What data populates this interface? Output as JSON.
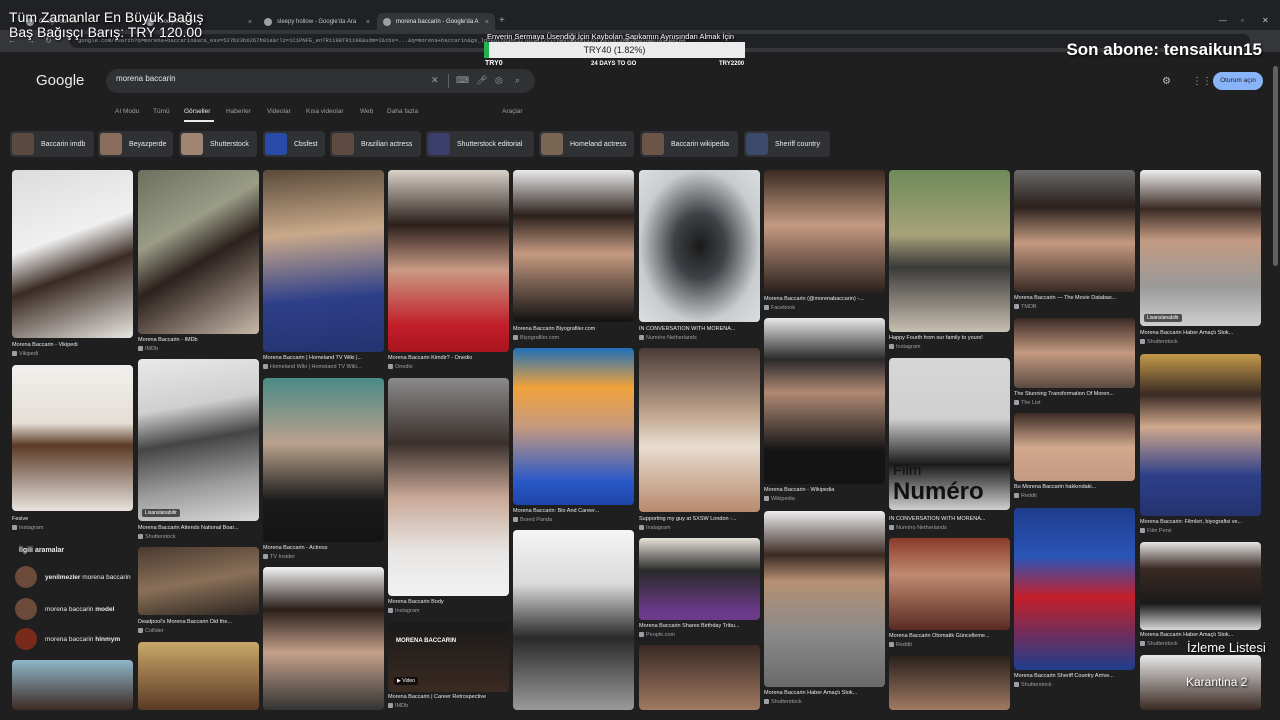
{
  "browser": {
    "tabs": [
      {
        "label": "Google'da Ara"
      },
      {
        "label": "Google'da Ara"
      },
      {
        "label": "sleepy hollow - Google'da Ara"
      },
      {
        "label": "morena baccarin - Google'da A"
      }
    ],
    "new_tab": "+",
    "url": "google.com/search?q=morena+baccarin&sca_esv=527b23b6267b91a&rlz=1C1PNFE_enTR1198TR1198&udm=2&tbs=...&q=morena+baccarin&gs_lp=Egtnd3Mtd2l6LWltZyIPbW9yZW5hIGJhY2NhcmluMgUQABiABDlASABAzAA"
  },
  "overlay": {
    "left_line1": "Tüm Zamanlar En Büyük Bağış",
    "left_line2": "Baş Bağışçı Barış: TRY 120.00",
    "goal_title": "Enverin Sermaya Üsendiği İçin Kaybolan Şapkamın Aynısından Almak İçin",
    "progress_text": "TRY40 (1.82%)",
    "progress_fraction": 0.0182,
    "goal_min": "TRY0",
    "goal_days": "24 DAYS TO GO",
    "goal_max": "TRY2200",
    "right_title": "Son abone: tensaikun15",
    "watch_label": "İzleme Listesi",
    "channel_label": "Karantina 2"
  },
  "google": {
    "logo": "Google",
    "query": "morena baccarin",
    "signin": "Oturum açın",
    "tabs": [
      "AI Modu",
      "Tümü",
      "Görseller",
      "Haberler",
      "Videolar",
      "Kısa videolar",
      "Web",
      "Daha fazla"
    ],
    "tools": "Araçlar",
    "chips": [
      "Baccarin imdb",
      "Beyazperde",
      "Shutterstock",
      "Cbsfest",
      "Brazilian actress",
      "Shutterstock editorial",
      "Homeland actress",
      "Baccarin wikipedia",
      "Sheriff country"
    ],
    "related_title": "İlgili aramalar",
    "related": [
      {
        "bold": "yenilmezler",
        "rest": " morena baccarin"
      },
      {
        "pre": "morena baccarin ",
        "bold": "model"
      },
      {
        "pre": "morena baccarin ",
        "bold": "hinmym"
      }
    ],
    "results": [
      {
        "cap": "Morena Baccarin - Vikipedi",
        "src": "Vikipedi"
      },
      {
        "cap": "Morena Baccarin - IMDb",
        "src": "IMDb"
      },
      {
        "cap": "Morena Baccarin | Homeland TV Wiki |...",
        "src": "Homeland Wiki | Homeland TV Wiki..."
      },
      {
        "cap": "Morena Baccarin Kimdir? - Onedio",
        "src": "Onedio"
      },
      {
        "cap": "Morena Baccarin Biyografiler.com",
        "src": "Biyografiler.com"
      },
      {
        "cap": "IN CONVERSATION WITH MORENA...",
        "src": "Numéro Netherlands"
      },
      {
        "cap": "Morena Baccarin (@morenabaccarin) -...",
        "src": "Facebook"
      },
      {
        "cap": "Happy Fourth from our family to yours!",
        "src": "Instagram"
      },
      {
        "cap": "Morena Baccarin — The Movie Databas...",
        "src": "TMDB"
      },
      {
        "cap": "Morena Baccarin Haber Amaçlı Stok...",
        "src": "Shutterstock"
      },
      {
        "cap": "Fesive",
        "src": "Instagram"
      },
      {
        "cap": "Morena Baccarin Attends National Boar...",
        "src": "Shutterstock"
      },
      {
        "cap": "Morena Baccarin - Actress",
        "src": "TV Insider"
      },
      {
        "cap": "Morena Baccarin Body",
        "src": "Instagram"
      },
      {
        "cap": "Morena Baccarin: Bio And Career...",
        "src": "Bored Panda"
      },
      {
        "cap": "Supporting my guy at SXSW London -...",
        "src": "Instagram"
      },
      {
        "cap": "Morena Baccarin - Wikipedia",
        "src": "Wikipedia"
      },
      {
        "cap": "IN CONVERSATION WITH MORENA...",
        "src": "Numéro Netherlands"
      },
      {
        "cap": "The Stunning Transformation Of Moren...",
        "src": "The List"
      },
      {
        "cap": "Bu Morena Baccarin hakkındaki...",
        "src": "Reddit"
      },
      {
        "cap": "Morena Baccarin: Filmleri, biyografisi ve...",
        "src": "Film Persi"
      },
      {
        "cap": "Deadpool's Morena Baccarin Did the...",
        "src": "Collider"
      },
      {
        "cap": "Morena Baccarin Shares Birthday Tribu...",
        "src": "People.com"
      },
      {
        "cap": "Morena Baccarin Haber Amaçlı Stok...",
        "src": "Shutterstock"
      },
      {
        "cap": "Morena Baccarin Otomatik Güncelleme...",
        "src": "Reddit"
      },
      {
        "cap": "Morena Baccarin Sheriff Country Arrive...",
        "src": "Shutterstock"
      },
      {
        "cap": "Morena Baccarin Haber Amaçlı Stok...",
        "src": "Shutterstock"
      },
      {
        "cap": "Morena Baccarin | Career Retrospective",
        "src": "IMDb"
      }
    ],
    "badges": {
      "licensable": "Lisanslanabilir",
      "video": "Video",
      "film_text": "Film",
      "numero_text": "Numéro",
      "poster_text": "MORENA BACCARIN"
    }
  }
}
